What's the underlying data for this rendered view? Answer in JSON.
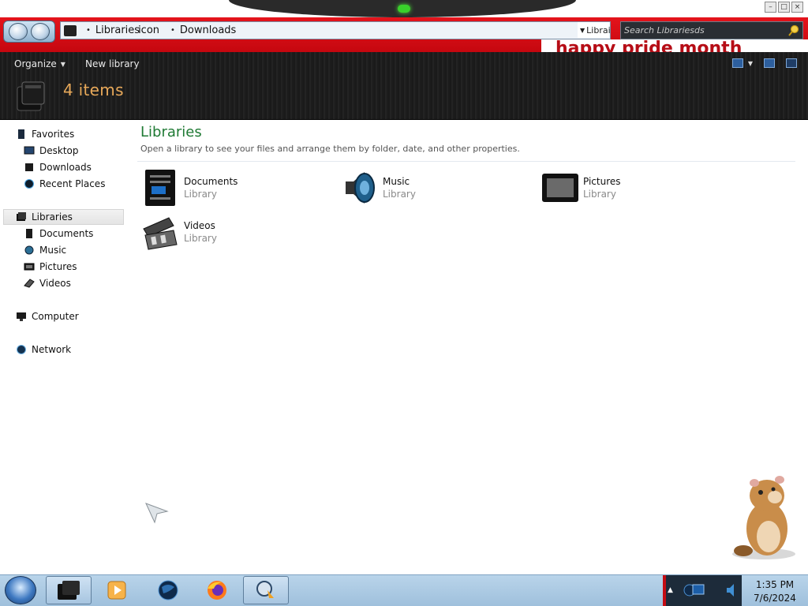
{
  "window": {
    "caption_buttons": [
      "minimize",
      "maximize",
      "close"
    ],
    "address": {
      "breadcrumbs": [
        "Libraries",
        "Downloads"
      ],
      "overlap_text": "icon",
      "dropdown_text": "Librai",
      "search_placeholder": "Search Librariesds"
    },
    "banner": "happy pride month",
    "toolbar": {
      "organize": "Organize",
      "new_library": "New library"
    },
    "details": {
      "count": "4 items"
    }
  },
  "nav": {
    "favorites": {
      "label": "Favorites",
      "items": [
        "Desktop",
        "Downloads",
        "Recent Places"
      ]
    },
    "libraries": {
      "label": "Libraries",
      "items": [
        "Documents",
        "Music",
        "Pictures",
        "Videos"
      ]
    },
    "computer": "Computer",
    "network": "Network"
  },
  "content": {
    "title": "Libraries",
    "subtitle": "Open a library to see your files and arrange them by folder, date, and other properties.",
    "tiles": [
      {
        "name": "Documents",
        "type": "Library",
        "icon": "documents-library-icon"
      },
      {
        "name": "Music",
        "type": "Library",
        "icon": "music-library-icon"
      },
      {
        "name": "Pictures",
        "type": "Library",
        "icon": "pictures-library-icon"
      },
      {
        "name": "Videos",
        "type": "Library",
        "icon": "videos-library-icon"
      }
    ]
  },
  "taskbar": {
    "apps": [
      "explorer",
      "media-player",
      "browser-globe",
      "firefox",
      "program-icon"
    ],
    "clock": {
      "time": "1:35 PM",
      "date": "7/6/2024"
    }
  },
  "colors": {
    "accent_red": "#d0101a",
    "library_title_green": "#1f7a34",
    "item_count_orange": "#e8a95a",
    "taskbar_blue": "#a9c8e2"
  }
}
